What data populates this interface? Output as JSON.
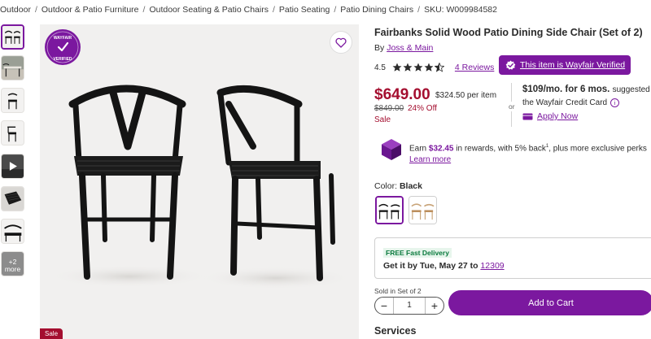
{
  "breadcrumb": {
    "items": [
      "Outdoor",
      "Outdoor & Patio Furniture",
      "Outdoor Seating & Patio Chairs",
      "Patio Seating",
      "Patio Dining Chairs"
    ],
    "separator": "/",
    "sku": "SKU: W009984582"
  },
  "gallery": {
    "more_label": "+2 more",
    "sale_tag": "Sale",
    "badge_top_text": "WAYFAIR",
    "badge_bottom_text": "VERIFIED"
  },
  "product": {
    "title": "Fairbanks Solid Wood Patio Dining Side Chair (Set of 2)",
    "by_prefix": "By",
    "brand": "Joss & Main",
    "rating": "4.5",
    "reviews": "4 Reviews",
    "verified_label": "This item is Wayfair Verified"
  },
  "pricing": {
    "price": "$649.00",
    "price_per": "$324.50 per item",
    "was_price": "$849.00",
    "discount": "24% Off",
    "sale": "Sale",
    "or_text": "or",
    "financing_amount": "$109/mo. for 6 mos.",
    "financing_suffix": "suggested",
    "financing_card": "the Wayfair Credit Card",
    "apply_now": "Apply Now"
  },
  "rewards": {
    "prefix": "Earn",
    "amount": "$32.45",
    "suffix": "in rewards, with 5% back",
    "superscript": "1",
    "suffix2": ", plus more exclusive perks",
    "learn_more": "Learn more"
  },
  "color": {
    "label": "Color:",
    "selected": "Black",
    "options": [
      "Black",
      "Natural"
    ]
  },
  "delivery": {
    "badge": "FREE Fast Delivery",
    "text": "Get it by Tue, May 27 to",
    "zip": "12309"
  },
  "cart": {
    "sold_in": "Sold in Set of 2",
    "quantity": "1",
    "minus": "−",
    "plus": "+",
    "add_to_cart": "Add to Cart"
  },
  "services": {
    "heading": "Services"
  },
  "colors": {
    "accent": "#7b189f",
    "sale_red": "#a40e2f",
    "green": "#0a7a3d"
  }
}
